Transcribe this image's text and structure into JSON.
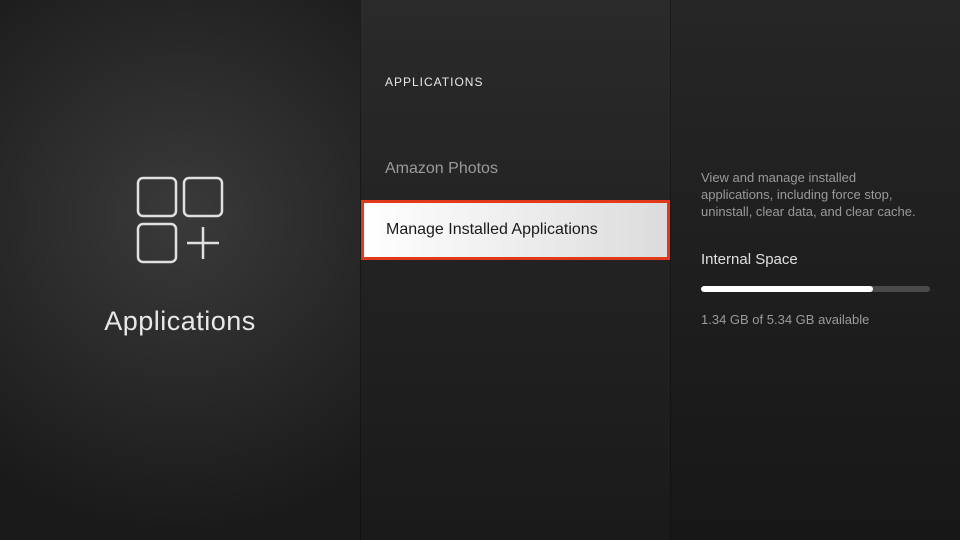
{
  "left": {
    "title": "Applications"
  },
  "middle": {
    "header": "APPLICATIONS",
    "items": [
      {
        "label": "Amazon Photos",
        "selected": false
      },
      {
        "label": "Manage Installed Applications",
        "selected": true
      }
    ]
  },
  "right": {
    "description": "View and manage installed applications, including force stop, uninstall, clear data, and clear cache.",
    "storage_label": "Internal Space",
    "storage_text": "1.34 GB of 5.34 GB available",
    "storage_used_percent": 75
  }
}
